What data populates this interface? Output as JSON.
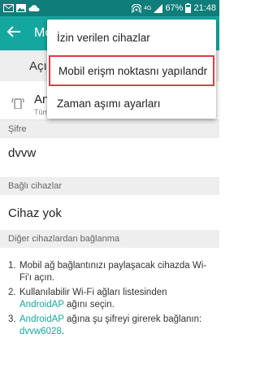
{
  "status_bar": {
    "network_type": "4G",
    "battery_percent": "67%",
    "time": "21:48",
    "icons": [
      "email-icon",
      "image-icon",
      "cloud-icon",
      "wifi-hotspot-icon",
      "signal-icon",
      "battery-icon"
    ]
  },
  "app_bar": {
    "title": "Mobi",
    "back_icon": "arrow-left-icon"
  },
  "toggle_row": {
    "label": "Açık"
  },
  "network": {
    "name": "An",
    "subtitle": "Tüm"
  },
  "sections": {
    "password_header": "Şifre",
    "password_value": "dvvw",
    "connected_header": "Bağlı cihazlar",
    "connected_value": "Cihaz yok",
    "other_header": "Diğer cihazlardan bağlanma"
  },
  "instructions": {
    "step1_num": "1.",
    "step1_text": "Mobil ağ bağlantınızı paylaşacak cihazda Wi-Fi'ı açın.",
    "step2_num": "2.",
    "step2_text_a": "Kullanılabilir Wi-Fi ağları listesinden",
    "step2_link": "AndroidAP",
    "step2_text_b": " ağını seçin.",
    "step3_num": "3.",
    "step3_link": "AndroidAP",
    "step3_text": " ağına şu şifreyi girerek bağlanın:",
    "step3_password": "dvvw6028",
    "step3_end": "."
  },
  "menu": {
    "items": [
      {
        "label": "İzin verilen cihazlar"
      },
      {
        "label": "Mobil erişm noktasnı yapılandr"
      },
      {
        "label": "Zaman aşımı ayarları"
      }
    ]
  },
  "colors": {
    "status_bar": "#0f7d79",
    "app_bar": "#14a79f",
    "link": "#14a79f",
    "highlight_border": "#e03a46"
  }
}
